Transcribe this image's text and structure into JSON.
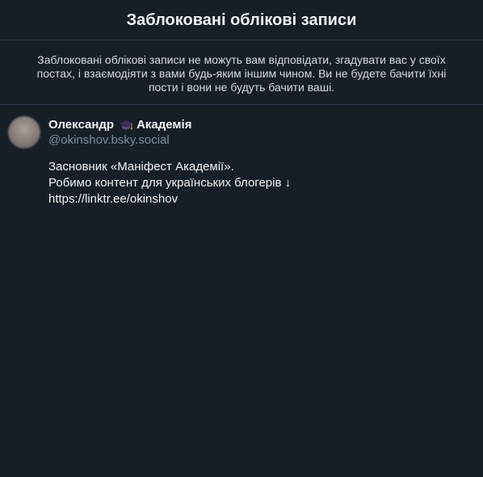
{
  "header": {
    "title": "Заблоковані облікові записи"
  },
  "description": {
    "text": "Заблоковані облікові записи не можуть вам відповідати, згадувати вас у своїх постах, і взаємодіяти з вами будь-яким іншим чином. Ви не будете бачити їхні пости і вони не будуть бачити ваші."
  },
  "accounts": [
    {
      "name_first": "Олександр",
      "icon": "graduation-cap-icon",
      "name_second": "Академія",
      "handle": "@okinshov.bsky.social",
      "bio": [
        "Засновник «Маніфест Академії».",
        "Робимо контент для українських блогерів ↓",
        "https://linktr.ee/okinshov"
      ]
    }
  ],
  "colors": {
    "background": "#161e27",
    "border": "#2e4052",
    "text": "#f1f3f5",
    "muted": "#788ea5"
  }
}
